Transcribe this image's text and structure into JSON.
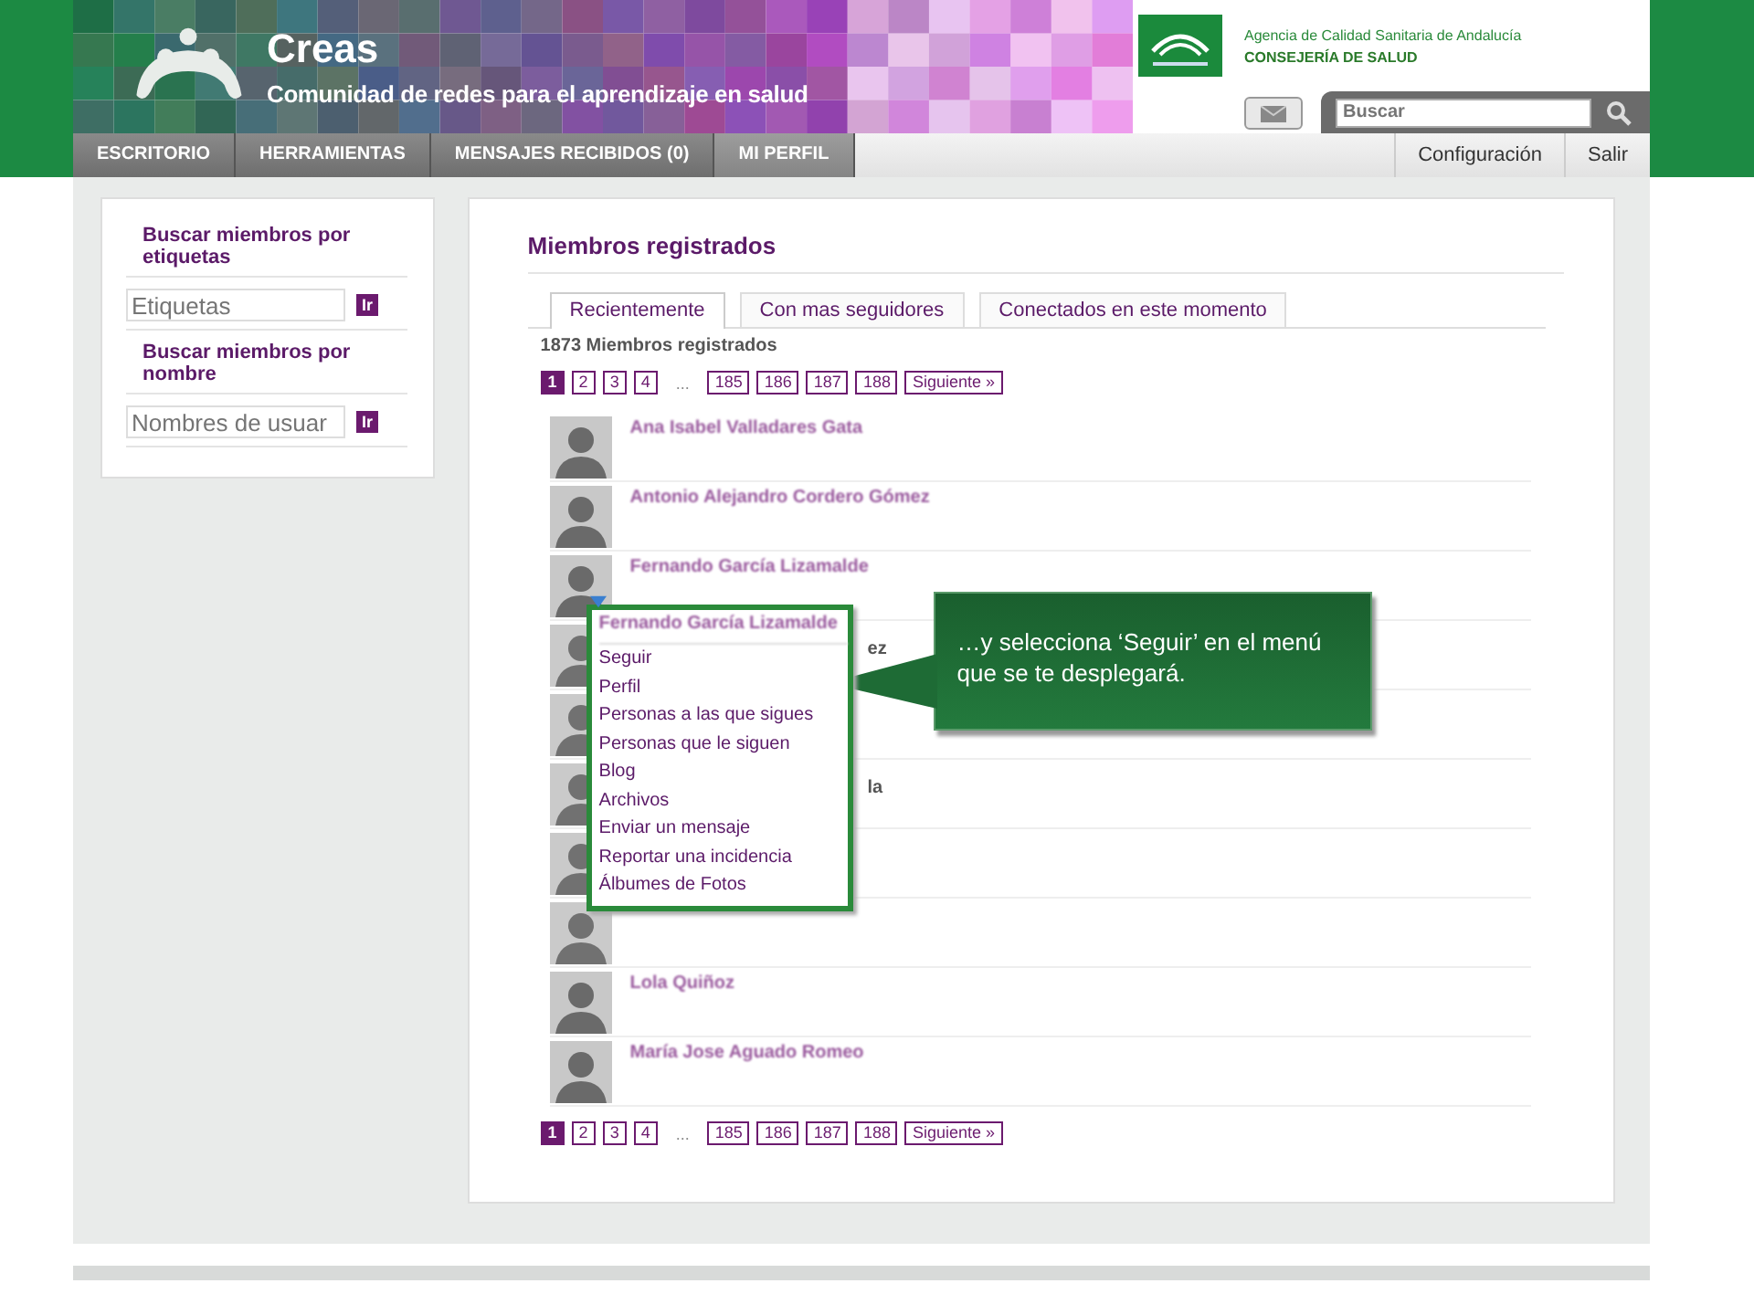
{
  "header": {
    "title": "Creas",
    "subtitle": "Comunidad de redes para el aprendizaje en salud",
    "agency": "Agencia de Calidad Sanitaria de Andalucía",
    "ministry": "CONSEJERÍA DE SALUD",
    "search": {
      "placeholder": "Buscar"
    }
  },
  "nav": {
    "items": [
      {
        "label": "ESCRITORIO",
        "selected": false
      },
      {
        "label": "HERRAMIENTAS",
        "selected": false
      },
      {
        "label": "MENSAJES RECIBIDOS (0)",
        "selected": false
      },
      {
        "label": "MI PERFIL",
        "selected": true
      }
    ],
    "right": [
      "Configuración",
      "Salir"
    ]
  },
  "sidebar": {
    "sections": [
      {
        "title": "Buscar miembros por etiquetas",
        "placeholder": "Etiquetas",
        "button": "Ir"
      },
      {
        "title": "Buscar miembros por nombre",
        "placeholder": "Nombres de usuar",
        "button": "Ir"
      }
    ]
  },
  "main": {
    "title": "Miembros registrados",
    "tabs": [
      {
        "label": "Recientemente",
        "selected": true
      },
      {
        "label": "Con mas seguidores",
        "selected": false
      },
      {
        "label": "Conectados en este momento",
        "selected": false
      }
    ],
    "count": "1873 Miembros registrados",
    "pages": [
      {
        "label": "1",
        "selected": true
      },
      {
        "label": "2",
        "selected": false
      },
      {
        "label": "3",
        "selected": false
      },
      {
        "label": "4",
        "selected": false
      },
      {
        "label": "...",
        "kind": "gap"
      },
      {
        "label": "185",
        "selected": false
      },
      {
        "label": "186",
        "selected": false
      },
      {
        "label": "187",
        "selected": false
      },
      {
        "label": "188",
        "selected": false
      },
      {
        "label": "Siguiente »",
        "selected": false
      }
    ],
    "members": [
      {
        "name": "Ana Isabel Valladares Gata",
        "kind": "full"
      },
      {
        "name": "Antonio Alejandro Cordero Gómez",
        "kind": "full"
      },
      {
        "name": "Fernando García Lizamalde",
        "kind": "full"
      },
      {
        "name": "ez",
        "kind": "covered"
      },
      {
        "kind": "covered"
      },
      {
        "name": "la",
        "kind": "covered"
      },
      {
        "kind": "covered"
      },
      {
        "kind": "covered"
      },
      {
        "name": "Lola Quiñoz",
        "kind": "full"
      },
      {
        "name": "María Jose Aguado Romeo",
        "kind": "full"
      }
    ],
    "bottom_pages": [
      {
        "label": "1",
        "selected": true
      },
      {
        "label": "2",
        "selected": false
      },
      {
        "label": "3",
        "selected": false
      },
      {
        "label": "4",
        "selected": false
      },
      {
        "label": "...",
        "kind": "gap"
      },
      {
        "label": "185",
        "selected": false
      },
      {
        "label": "186",
        "selected": false
      },
      {
        "label": "187",
        "selected": false
      },
      {
        "label": "188",
        "selected": false
      },
      {
        "label": "Siguiente »",
        "selected": false
      }
    ]
  },
  "popup_menu": {
    "title": "Fernando García Lizamalde",
    "items": [
      "Seguir",
      "Perfil",
      "Personas a las que sigues",
      "Personas que le siguen",
      "Blog",
      "Archivos",
      "Enviar un mensaje",
      "Reportar una incidencia",
      "Álbumes de Fotos"
    ]
  },
  "callout": {
    "text": "…y selecciona ‘Seguir’ en el menú que se te desplegará."
  }
}
